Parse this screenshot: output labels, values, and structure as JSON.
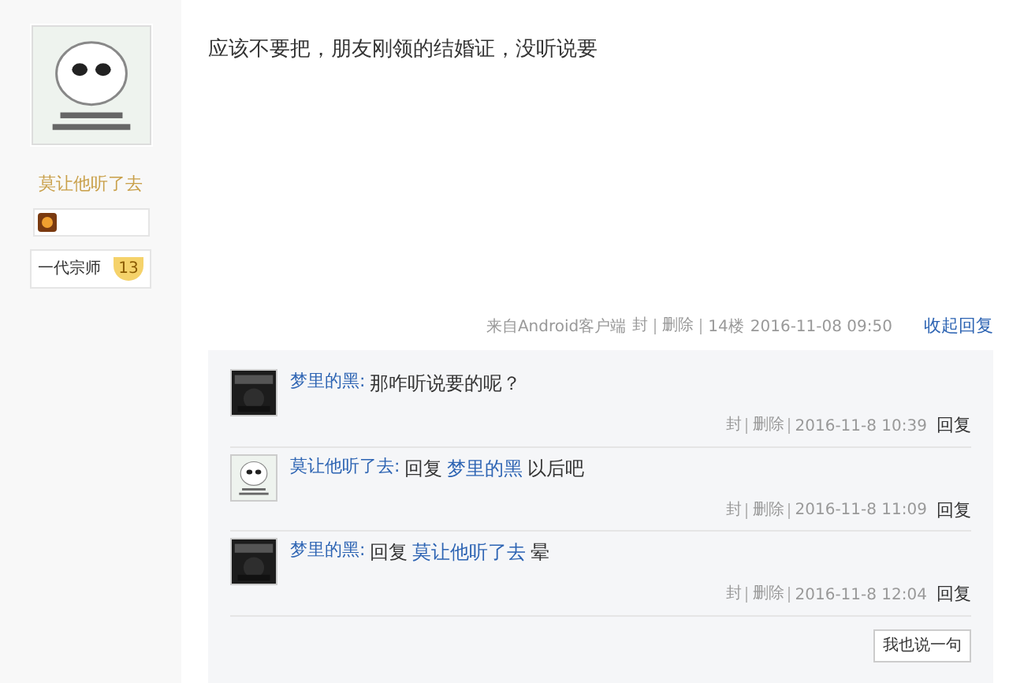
{
  "author": {
    "name": "莫让他听了去",
    "level_title": "一代宗师",
    "level": "13"
  },
  "post": {
    "content": "应该不要把，朋友刚领的结婚证，没听说要",
    "source": "来自Android客户端",
    "ban": "封",
    "delete": "删除",
    "floor": "14楼",
    "time": "2016-11-08 09:50",
    "toggle_replies": "收起回复"
  },
  "replies": [
    {
      "user": "梦里的黑:",
      "parts": [
        {
          "kind": "text",
          "text": "那咋听说要的呢？"
        }
      ],
      "ban": "封",
      "delete": "删除",
      "time": "2016-11-8 10:39",
      "reply": "回复"
    },
    {
      "user": "莫让他听了去:",
      "parts": [
        {
          "kind": "text",
          "text": "回复"
        },
        {
          "kind": "link",
          "text": "梦里的黑"
        },
        {
          "kind": "text",
          "text": "以后吧"
        }
      ],
      "ban": "封",
      "delete": "删除",
      "time": "2016-11-8 11:09",
      "reply": "回复"
    },
    {
      "user": "梦里的黑:",
      "parts": [
        {
          "kind": "text",
          "text": "回复"
        },
        {
          "kind": "link",
          "text": "莫让他听了去"
        },
        {
          "kind": "text",
          "text": "晕"
        }
      ],
      "ban": "封",
      "delete": "删除",
      "time": "2016-11-8 12:04",
      "reply": "回复"
    }
  ],
  "reply_button": "我也说一句"
}
